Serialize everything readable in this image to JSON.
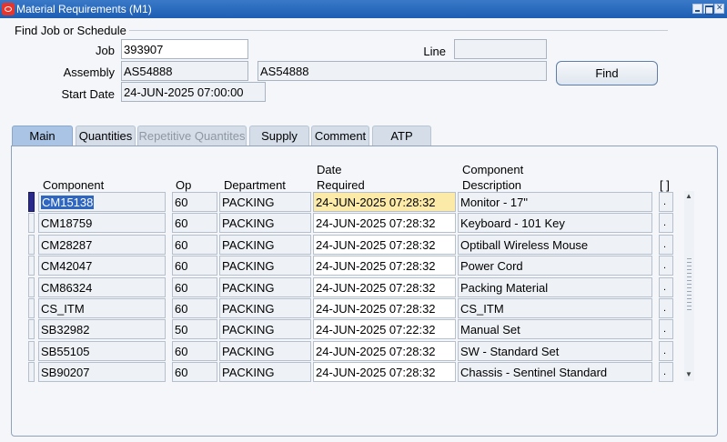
{
  "window": {
    "title": "Material Requirements (M1)"
  },
  "find": {
    "section_title": "Find Job or Schedule",
    "job_label": "Job",
    "job_value": "393907",
    "line_label": "Line",
    "line_value": "",
    "assembly_label": "Assembly",
    "assembly_value": "AS54888",
    "assembly_desc": "AS54888",
    "start_date_label": "Start Date",
    "start_date_value": "24-JUN-2025 07:00:00",
    "find_button": "Find"
  },
  "tabs": [
    {
      "label": "Main",
      "state": "active"
    },
    {
      "label": "Quantities",
      "state": "normal"
    },
    {
      "label": "Repetitive Quantites",
      "state": "disabled"
    },
    {
      "label": "Supply",
      "state": "normal"
    },
    {
      "label": "Comment",
      "state": "normal"
    },
    {
      "label": "ATP",
      "state": "normal"
    }
  ],
  "table": {
    "headers": {
      "component": "Component",
      "op": "Op",
      "department": "Department",
      "date_line1": "Date",
      "date_line2": "Required",
      "desc_line1": "Component",
      "desc_line2": "Description",
      "bracket": "[ ]"
    },
    "rows": [
      {
        "component": "CM15138",
        "op": "60",
        "department": "PACKING",
        "date": "24-JUN-2025 07:28:32",
        "description": "Monitor - 17\"",
        "dot": "."
      },
      {
        "component": "CM18759",
        "op": "60",
        "department": "PACKING",
        "date": "24-JUN-2025 07:28:32",
        "description": "Keyboard - 101 Key",
        "dot": "."
      },
      {
        "component": "CM28287",
        "op": "60",
        "department": "PACKING",
        "date": "24-JUN-2025 07:28:32",
        "description": "Optiball Wireless Mouse",
        "dot": "."
      },
      {
        "component": "CM42047",
        "op": "60",
        "department": "PACKING",
        "date": "24-JUN-2025 07:28:32",
        "description": "Power Cord",
        "dot": "."
      },
      {
        "component": "CM86324",
        "op": "60",
        "department": "PACKING",
        "date": "24-JUN-2025 07:28:32",
        "description": "Packing Material",
        "dot": "."
      },
      {
        "component": "CS_ITM",
        "op": "60",
        "department": "PACKING",
        "date": "24-JUN-2025 07:28:32",
        "description": "CS_ITM",
        "dot": "."
      },
      {
        "component": "SB32982",
        "op": "50",
        "department": "PACKING",
        "date": "24-JUN-2025 07:22:32",
        "description": "Manual Set",
        "dot": "."
      },
      {
        "component": "SB55105",
        "op": "60",
        "department": "PACKING",
        "date": "24-JUN-2025 07:28:32",
        "description": "SW - Standard Set",
        "dot": "."
      },
      {
        "component": "SB90207",
        "op": "60",
        "department": "PACKING",
        "date": "24-JUN-2025 07:28:32",
        "description": "Chassis - Sentinel Standard",
        "dot": "."
      }
    ]
  },
  "colors": {
    "titlebar": "#1d5eb3",
    "active_tab": "#a9c4e4",
    "highlight_cell": "#fbeaa8",
    "selection": "#2f66c0"
  },
  "icons": {
    "app": "oracle-app-icon",
    "minimize": "minimize-icon",
    "maximize": "maximize-icon",
    "close": "close-icon",
    "scroll_up": "scroll-up-arrow-icon",
    "scroll_down": "scroll-down-arrow-icon"
  }
}
